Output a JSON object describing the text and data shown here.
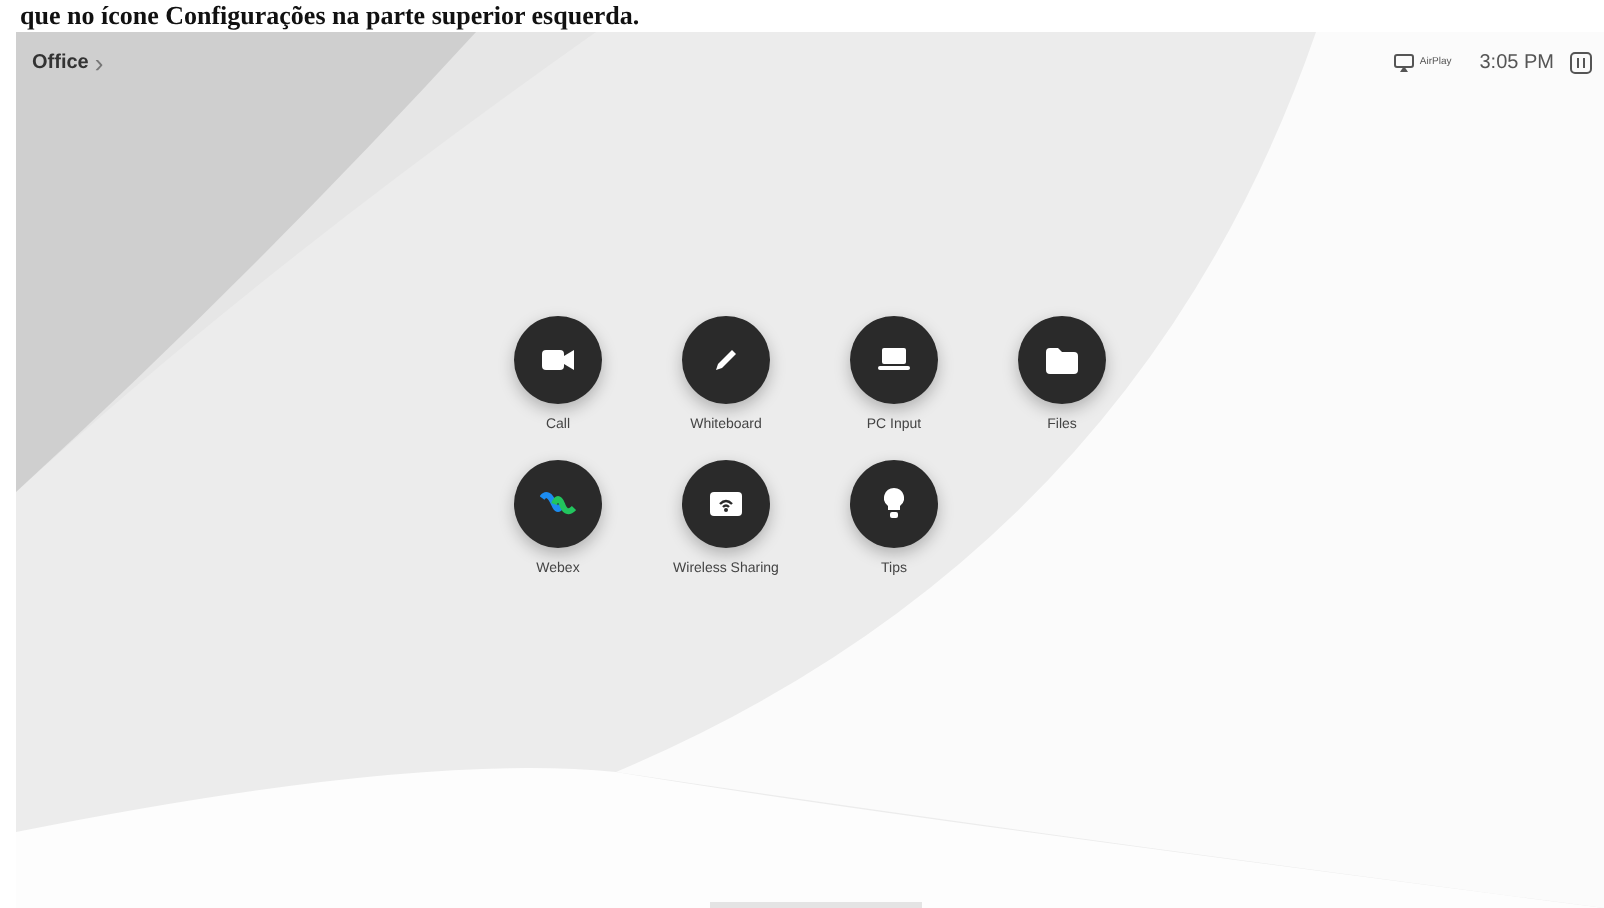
{
  "caption": "que no ícone Configurações na parte superior esquerda.",
  "top_bar": {
    "location": "Office",
    "chevron": "›",
    "airplay": "AirPlay",
    "time": "3:05 PM"
  },
  "apps": [
    {
      "label": "Call",
      "kind": "camera"
    },
    {
      "label": "Whiteboard",
      "kind": "pen"
    },
    {
      "label": "PC Input",
      "kind": "laptop"
    },
    {
      "label": "Files",
      "kind": "folder"
    },
    {
      "label": "Webex",
      "kind": "webex"
    },
    {
      "label": "Wireless Sharing",
      "kind": "cast"
    },
    {
      "label": "Tips",
      "kind": "bulb"
    }
  ]
}
